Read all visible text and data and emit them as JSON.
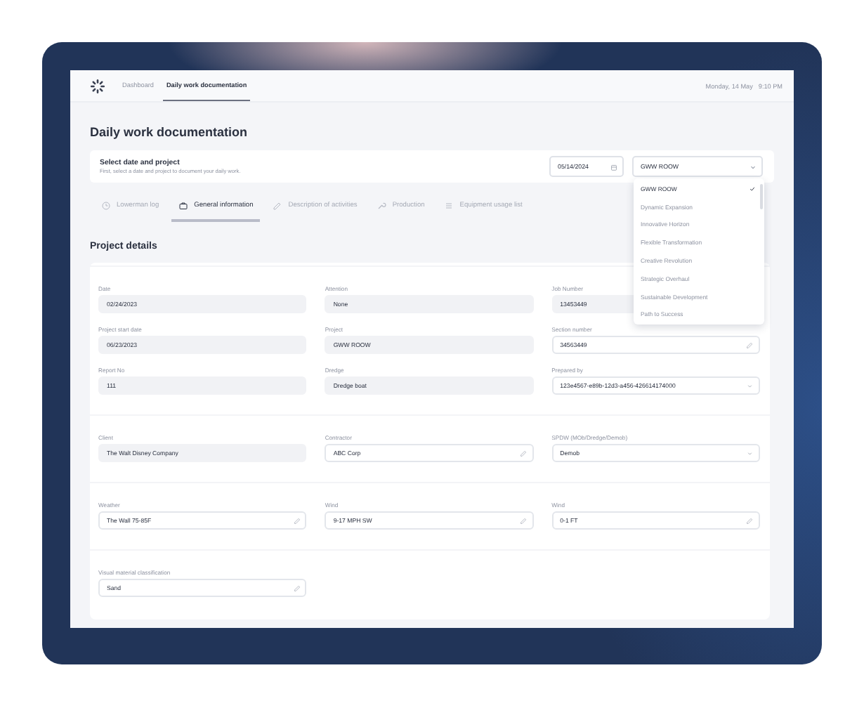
{
  "nav": {
    "items": [
      {
        "label": "Dashboard",
        "selected": false
      },
      {
        "label": "Daily work documentation",
        "selected": true
      }
    ],
    "date": "Monday, 14 May",
    "time": "9:10 PM"
  },
  "page_title": "Daily work documentation",
  "selection": {
    "title": "Select date and project",
    "subtitle": "First, select a date and project to document your daily work.",
    "date_field": {
      "value": "05/14/2024"
    },
    "project_select": {
      "value": "GWW ROOW"
    }
  },
  "tabs": [
    {
      "label": "Lowerman log",
      "selected": false
    },
    {
      "label": "General information",
      "selected": true
    },
    {
      "label": "Description of activities",
      "selected": false
    },
    {
      "label": "Production",
      "selected": false
    },
    {
      "label": "Equipment usage list",
      "selected": false
    }
  ],
  "section_title": "Project details",
  "field_groups": [
    {
      "fields": [
        {
          "label": "Date",
          "value": "02/24/2023",
          "kind": "readonly"
        },
        {
          "label": "Attention",
          "value": "None",
          "kind": "readonly"
        },
        {
          "label": "Job Number",
          "value": "13453449",
          "kind": "readonly"
        },
        {
          "label": "Project start date",
          "value": "06/23/2023",
          "kind": "readonly"
        },
        {
          "label": "Project",
          "value": "GWW ROOW",
          "kind": "readonly"
        },
        {
          "label": "Section number",
          "value": "34563449",
          "kind": "edit"
        },
        {
          "label": "Report No",
          "value": "111",
          "kind": "readonly"
        },
        {
          "label": "Dredge",
          "value": "Dredge boat",
          "kind": "readonly"
        },
        {
          "label": "Prepared by",
          "value": "123e4567-e89b-12d3-a456-426614174000",
          "kind": "select"
        }
      ]
    },
    {
      "fields": [
        {
          "label": "Client",
          "value": "The Walt Disney Company",
          "kind": "readonly"
        },
        {
          "label": "Contractor",
          "value": "ABC Corp",
          "kind": "edit"
        },
        {
          "label": "SPDW (MOb/Dredge/Demob)",
          "value": "Demob",
          "kind": "select"
        }
      ]
    },
    {
      "fields": [
        {
          "label": "Weather",
          "value": "The Wall 75-85F",
          "kind": "edit"
        },
        {
          "label": "Wind",
          "value": "9-17 MPH SW",
          "kind": "edit"
        },
        {
          "label": "Wind",
          "value": "0-1 FT",
          "kind": "edit"
        }
      ]
    },
    {
      "fields": [
        {
          "label": "Visual material classification",
          "value": "Sand",
          "kind": "edit"
        }
      ]
    }
  ],
  "project_dropdown": {
    "options": [
      {
        "label": "GWW ROOW",
        "selected": true
      },
      {
        "label": "Dynamic Expansion",
        "selected": false
      },
      {
        "label": "Innovative Horizon",
        "selected": false
      },
      {
        "label": "Flexible Transformation",
        "selected": false
      },
      {
        "label": "Creative Revolution",
        "selected": false
      },
      {
        "label": "Strategic Overhaul",
        "selected": false
      },
      {
        "label": "Sustainable Development",
        "selected": false
      },
      {
        "label": "Path to Success",
        "selected": false
      }
    ]
  }
}
